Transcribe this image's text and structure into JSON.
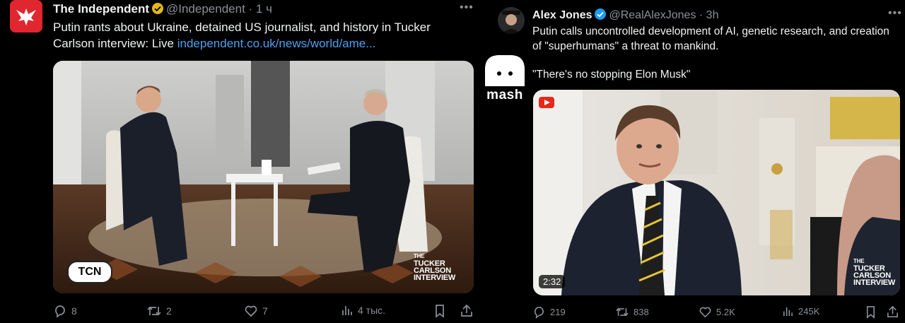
{
  "left_post": {
    "name": "The Independent",
    "handle": "@Independent",
    "time": "· 1 ч",
    "text": "Putin rants about Ukraine, detained US journalist, and history in Tucker Carlson interview: Live",
    "link": "independent.co.uk/news/world/ame...",
    "media": {
      "logo_text": "TCN",
      "watermark_line1": "THE",
      "watermark_line2": "TUCKER",
      "watermark_line3": "CARLSON",
      "watermark_line4": "INTERVIEW"
    },
    "replies": "8",
    "reposts": "2",
    "likes": "7",
    "views": "4 тыс."
  },
  "right_post": {
    "name": "Alex Jones",
    "handle": "@RealAlexJones",
    "time": "· 3h",
    "text_line1": "Putin calls uncontrolled development of AI, genetic research, and creation of \"superhumans\" a threat to mankind.",
    "text_line2": "\"There's no stopping Elon Musk\"",
    "media": {
      "duration": "2:32",
      "watermark_line1": "THE",
      "watermark_line2": "TUCKER",
      "watermark_line3": "CARLSON",
      "watermark_line4": "INTERVIEW"
    },
    "replies": "219",
    "reposts": "838",
    "likes": "5.2K",
    "views": "245K"
  },
  "overlay": {
    "mash_text": "mash"
  },
  "colors": {
    "background": "#000000",
    "link": "#4ea0f2",
    "verified_gold": "#e2b719",
    "verified_blue": "#1d9bf0",
    "muted": "#8b9096"
  }
}
